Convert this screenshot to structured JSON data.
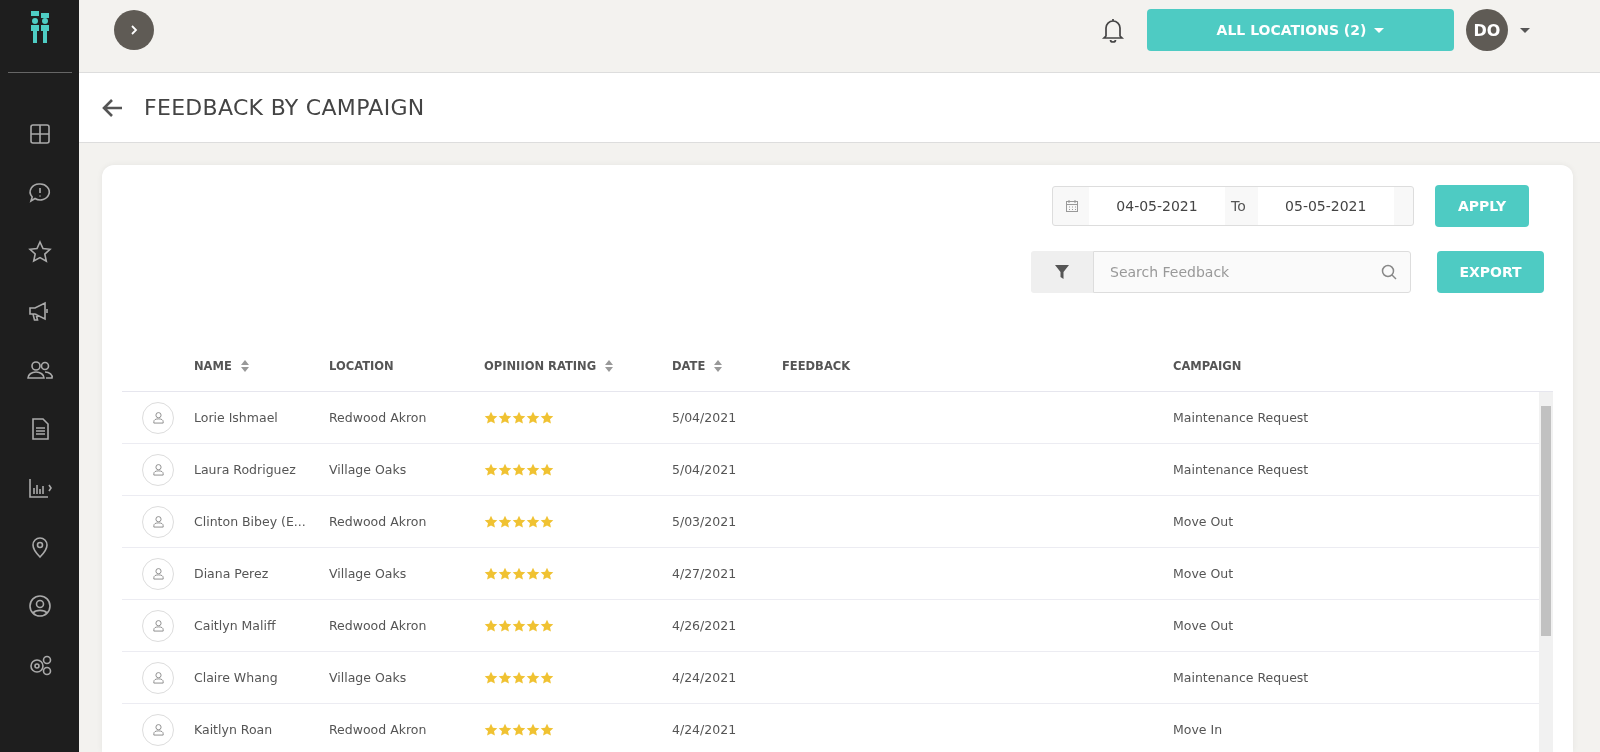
{
  "topbar": {
    "locations_button": "ALL LOCATIONS (2)",
    "avatar_initials": "DO"
  },
  "page_title": "FEEDBACK BY CAMPAIGN",
  "filters": {
    "date_from": "04-05-2021",
    "date_separator": "To",
    "date_to": "05-05-2021",
    "apply_button": "APPLY",
    "search": {
      "placeholder": "Search Feedback"
    },
    "export_button": "EXPORT"
  },
  "table": {
    "columns": [
      {
        "label": "NAME",
        "sortable": true
      },
      {
        "label": "LOCATION",
        "sortable": false
      },
      {
        "label": "OPINIION RATING",
        "sortable": true
      },
      {
        "label": "DATE",
        "sortable": true
      },
      {
        "label": "FEEDBACK",
        "sortable": false
      },
      {
        "label": "CAMPAIGN",
        "sortable": false
      }
    ],
    "rows": [
      {
        "name": "Lorie Ishmael",
        "location": "Redwood Akron",
        "stars": 5,
        "date": "5/04/2021",
        "feedback": "",
        "campaign": "Maintenance Request"
      },
      {
        "name": "Laura Rodriguez",
        "location": "Village Oaks",
        "stars": 5,
        "date": "5/04/2021",
        "feedback": "",
        "campaign": "Maintenance Request"
      },
      {
        "name": "Clinton Bibey (E...",
        "location": "Redwood Akron",
        "stars": 5,
        "date": "5/03/2021",
        "feedback": "",
        "campaign": "Move Out"
      },
      {
        "name": "Diana Perez",
        "location": "Village Oaks",
        "stars": 5,
        "date": "4/27/2021",
        "feedback": "",
        "campaign": "Move Out"
      },
      {
        "name": "Caitlyn Maliff",
        "location": "Redwood Akron",
        "stars": 5,
        "date": "4/26/2021",
        "feedback": "",
        "campaign": "Move Out"
      },
      {
        "name": "Claire Whang",
        "location": "Village Oaks",
        "stars": 5,
        "date": "4/24/2021",
        "feedback": "",
        "campaign": "Maintenance Request"
      },
      {
        "name": "Kaitlyn Roan",
        "location": "Redwood Akron",
        "stars": 5,
        "date": "4/24/2021",
        "feedback": "",
        "campaign": "Move In"
      }
    ]
  }
}
